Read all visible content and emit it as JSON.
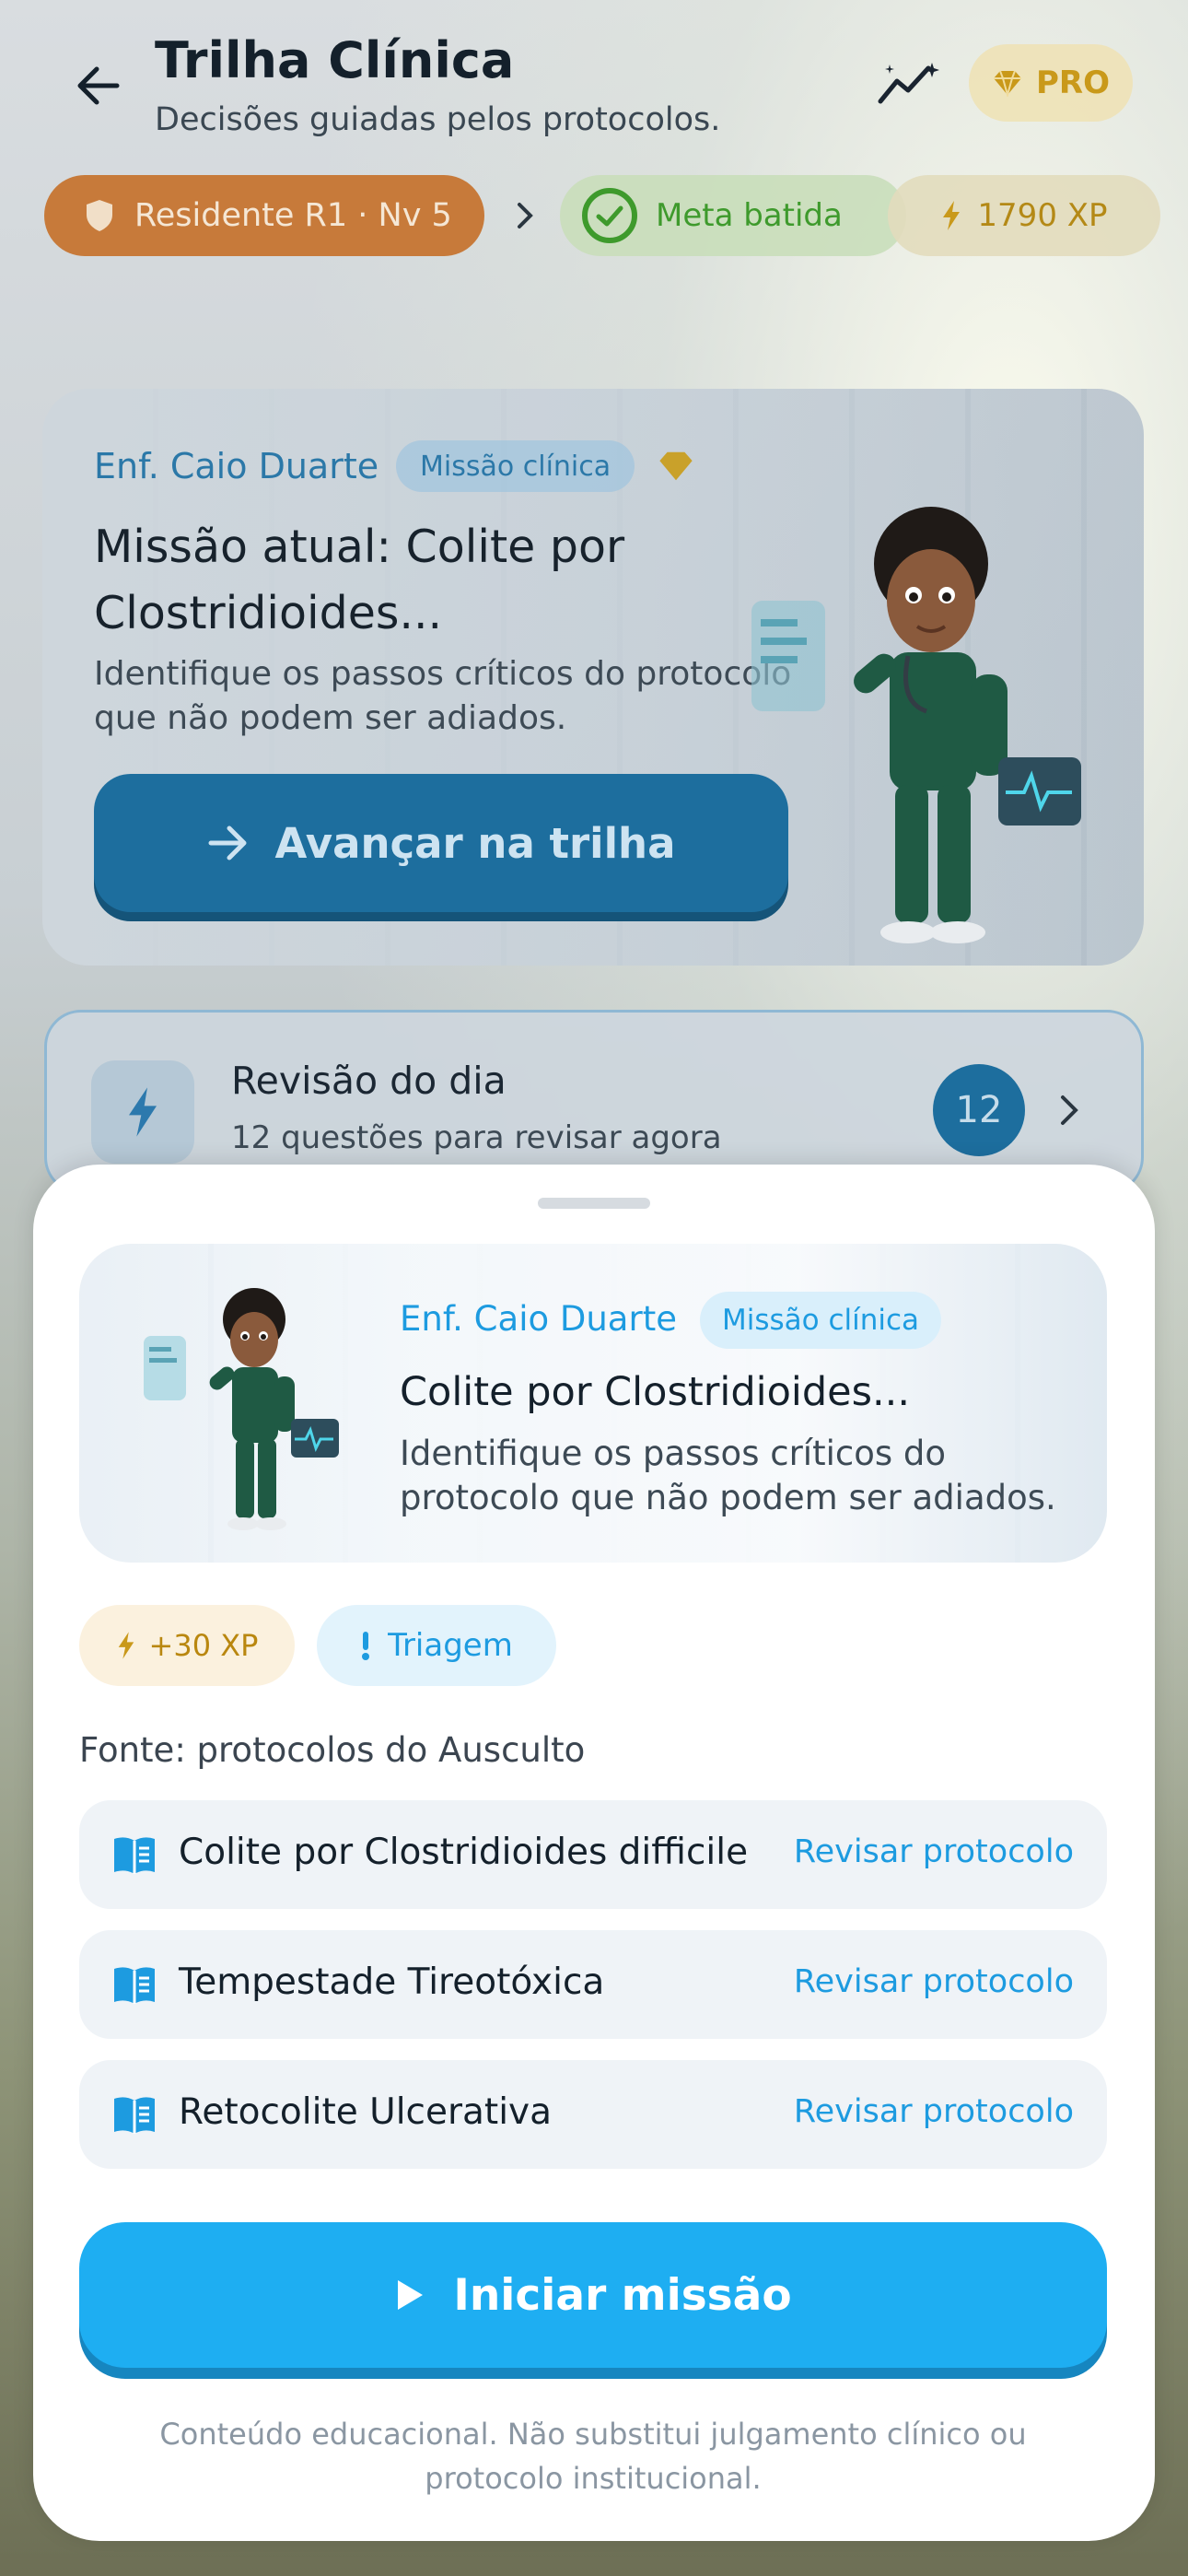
{
  "header": {
    "title": "Trilha Clínica",
    "subtitle": "Decisões guiadas pelos protocolos.",
    "pro_label": "PRO"
  },
  "status": {
    "rank_label": "Residente R1 · Nv 5",
    "goal_label": "Meta batida",
    "xp_label": "1790 XP"
  },
  "hero": {
    "author": "Enf. Caio Duarte",
    "tag": "Missão clínica",
    "title": "Missão atual: Colite por Clostridioides...",
    "description": "Identifique os passos críticos do protocolo que não podem ser adiados.",
    "button_label": "Avançar na trilha"
  },
  "review": {
    "title": "Revisão do dia",
    "subtitle": "12 questões para revisar agora",
    "count": "12"
  },
  "sheet": {
    "card": {
      "author": "Enf. Caio Duarte",
      "tag": "Missão clínica",
      "title": "Colite por Clostridioides...",
      "description": "Identifique os passos críticos do protocolo que não podem ser adiados."
    },
    "badges": {
      "xp": "+30 XP",
      "category": "Triagem"
    },
    "source_label": "Fonte: protocolos do Ausculto",
    "protocols": [
      {
        "name": "Colite por Clostridioides difficile",
        "action": "Revisar protocolo"
      },
      {
        "name": "Tempestade Tireotóxica",
        "action": "Revisar protocolo"
      },
      {
        "name": "Retocolite Ulcerativa",
        "action": "Revisar protocolo"
      }
    ],
    "start_label": "Iniciar missão",
    "disclaimer": "Conteúdo educacional. Não substitui julgamento clínico ou protocolo institucional."
  },
  "colors": {
    "primary": "#1eaef2",
    "primary_dark": "#1686c0",
    "gold": "#c9991a",
    "success": "#3e9a2c",
    "rank_orange": "#c77a3a"
  },
  "icons": {
    "back": "arrow-left-icon",
    "trend": "trend-sparkle-icon",
    "pro": "diamond-icon",
    "rank": "shield-icon",
    "goal": "check-circle-icon",
    "xp": "bolt-icon",
    "protocol": "book-icon",
    "start": "play-icon"
  }
}
